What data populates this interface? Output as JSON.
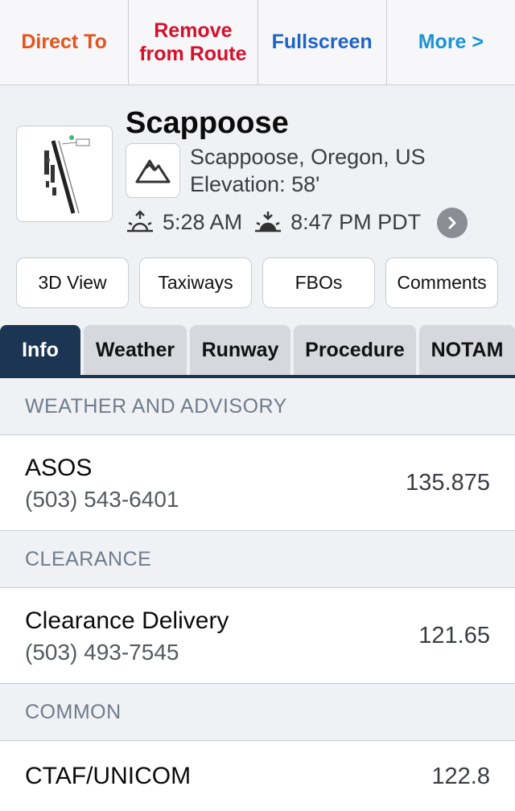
{
  "toolbar": {
    "direct_to": "Direct To",
    "remove_from_route": "Remove from Route",
    "fullscreen": "Fullscreen",
    "more": "More >"
  },
  "airport": {
    "name": "Scappoose",
    "location": "Scappoose, Oregon, US",
    "elevation": "Elevation: 58'",
    "sunrise": "5:28 AM",
    "sunset": "8:47 PM PDT",
    "icons": {
      "type": "mountain-icon",
      "sunrise": "sunrise-icon",
      "sunset": "sunset-icon",
      "details": "chevron-right-icon"
    }
  },
  "pills": [
    "3D View",
    "Taxiways",
    "FBOs",
    "Comments"
  ],
  "tabs": [
    "Info",
    "Weather",
    "Runway",
    "Procedure",
    "NOTAM"
  ],
  "active_tab": "Info",
  "sections": [
    {
      "header": "WEATHER AND ADVISORY",
      "name": "ASOS",
      "phone": "(503) 543-6401",
      "freq": "135.875"
    },
    {
      "header": "CLEARANCE",
      "name": "Clearance Delivery",
      "phone": "(503) 493-7545",
      "freq": "121.65"
    },
    {
      "header": "COMMON",
      "name": "CTAF/UNICOM",
      "phone": "",
      "freq": "122.8"
    }
  ],
  "colors": {
    "direct_to": "#e4531c",
    "remove": "#d4102c",
    "fullscreen": "#1e64c8",
    "more": "#1a93d6",
    "active_tab": "#1c3553"
  }
}
